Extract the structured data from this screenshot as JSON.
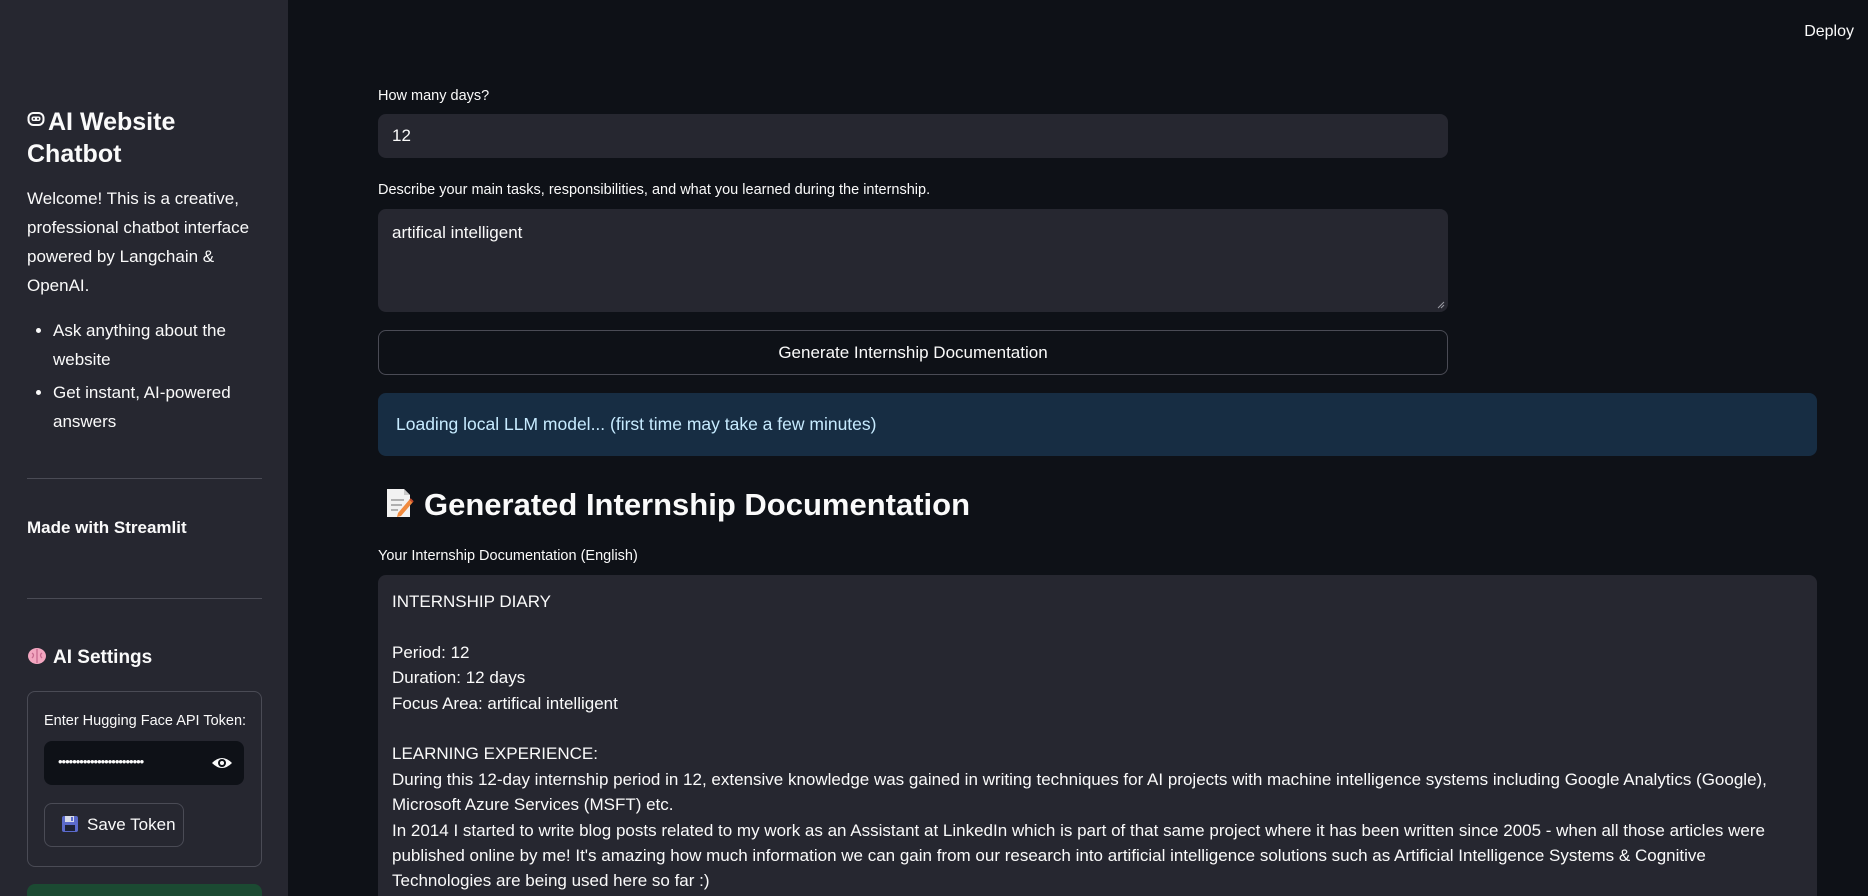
{
  "header": {
    "deploy_label": "Deploy"
  },
  "sidebar": {
    "title": "AI Website Chatbot",
    "title_icon": "robot-face-icon",
    "welcome": "Welcome! This is a creative, professional chatbot interface powered by Langchain & OpenAI.",
    "bullets": [
      "Ask anything about the website",
      "Get instant, AI-powered answers"
    ],
    "made_with": "Made with Streamlit",
    "settings_heading": "AI Settings",
    "settings_icon": "brain-icon",
    "token_label": "Enter Hugging Face API Token:",
    "token_value": "••••••••••••••••••••••••",
    "save_label": "Save Token",
    "save_icon": "floppy-disk-icon"
  },
  "main": {
    "days_label": "How many days?",
    "days_value": "12",
    "tasks_label": "Describe your main tasks, responsibilities, and what you learned during the internship.",
    "tasks_value": "artifical intelligent",
    "generate_label": "Generate Internship Documentation",
    "info_message": "Loading local LLM model... (first time may take a few minutes)",
    "doc_heading": "Generated Internship Documentation",
    "doc_heading_icon": "memo-icon",
    "doc_label": "Your Internship Documentation (English)",
    "doc_lines": [
      "INTERNSHIP DIARY",
      "",
      "Period: 12",
      "Duration: 12 days",
      "Focus Area: artifical intelligent",
      "",
      "LEARNING EXPERIENCE:",
      "During this 12-day internship period in 12, extensive knowledge was gained in writing techniques for AI projects with machine intelligence systems including Google Analytics (Google), Microsoft Azure Services (MSFT) etc.",
      "In 2014 I started to write blog posts related to my work as an Assistant at LinkedIn which is part of that same project where it has been written since 2005 - when all those articles were published online by me! It's amazing how much information we can gain from our research into artificial intelligence solutions such as Artificial Intelligence Systems & Cognitive Technologies are being used here so far :)"
    ]
  },
  "colors": {
    "background": "#0e1117",
    "sidebar": "#262730",
    "input": "#262730",
    "info_bg": "#172d43",
    "info_text": "#c7ebff",
    "border": "#4a4b55"
  }
}
